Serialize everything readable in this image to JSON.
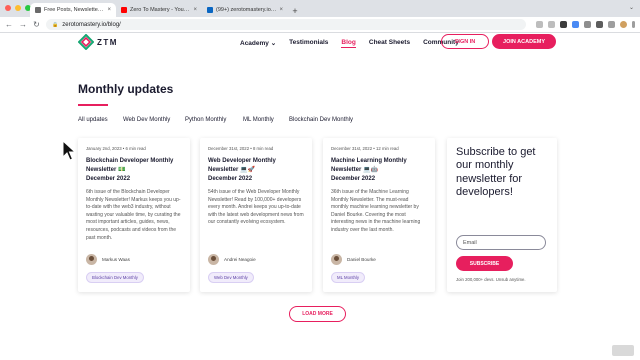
{
  "browser": {
    "tabs": [
      {
        "title": "Free Posts, Newsletters, Guide",
        "favicon_color": "#6a6a6a",
        "active": true
      },
      {
        "title": "Zero To Mastery - YouTube",
        "favicon_color": "#ff0000",
        "active": false
      },
      {
        "title": "(99+) zerotomastery.io | Grou",
        "favicon_color": "#0a66c2",
        "active": false
      }
    ],
    "new_tab": "+",
    "tab_menu": "⌄",
    "url": "zerotomastery.io/blog/"
  },
  "site": {
    "logo_text": "ZTM",
    "nav": [
      {
        "label": "Academy ⌄",
        "active": false
      },
      {
        "label": "Testimonials",
        "active": false
      },
      {
        "label": "Blog",
        "active": true
      },
      {
        "label": "Cheat Sheets",
        "active": false
      },
      {
        "label": "Community",
        "active": false
      }
    ],
    "sign_in": "SIGN IN",
    "join": "JOIN ACADEMY"
  },
  "section": {
    "title": "Monthly updates",
    "filters": [
      "All updates",
      "Web Dev Monthly",
      "Python Monthly",
      "ML Monthly",
      "Blockchain Dev Monthly"
    ]
  },
  "cards": [
    {
      "meta": "January 2nd, 2023  •  6 min read",
      "title_lines": [
        "Blockchain Developer Monthly",
        "Newsletter 💵",
        "December 2022"
      ],
      "description": "6th issue of the Blockchain Developer Monthly Newsletter! Markus keeps you up-to-date with the web3 industry, without wasting your valuable time, by curating the most important articles, guides, news, resources, podcasts and videos from the past month.",
      "author": "Markus Waas",
      "tag": "Blockchain Dev Monthly"
    },
    {
      "meta": "December 31st, 2022  •  8 min read",
      "title_lines": [
        "Web Developer Monthly",
        "Newsletter 💻🚀",
        "December 2022"
      ],
      "description": "54th issue of the Web Developer Monthly Newsletter! Read by 100,000+ developers every month. Andrei keeps you up-to-date with the latest web development news from our constantly evolving ecosystem.",
      "author": "Andrei Neagoie",
      "tag": "Web Dev Monthly"
    },
    {
      "meta": "December 31st, 2022  •  12 min read",
      "title_lines": [
        "Machine Learning Monthly",
        "Newsletter 💻🤖",
        "December 2022"
      ],
      "description": "36th issue of the Machine Learning Monthly Newsletter. The must-read monthly machine learning newsletter by Daniel Bourke. Covering the most interesting news in the machine learning industry over the last month.",
      "author": "Daniel Bourke",
      "tag": "ML Monthly"
    }
  ],
  "subscribe": {
    "title": "Subscribe to get our monthly newsletter for developers!",
    "email_placeholder": "Email",
    "button": "SUBSCRIBE",
    "note": "Join 200,000+ devs. Unsub anytime."
  },
  "load_more": "LOAD MORE",
  "colors": {
    "accent": "#e71f5e",
    "text": "#1a1a2e",
    "tag_text": "#5b3fa5"
  }
}
